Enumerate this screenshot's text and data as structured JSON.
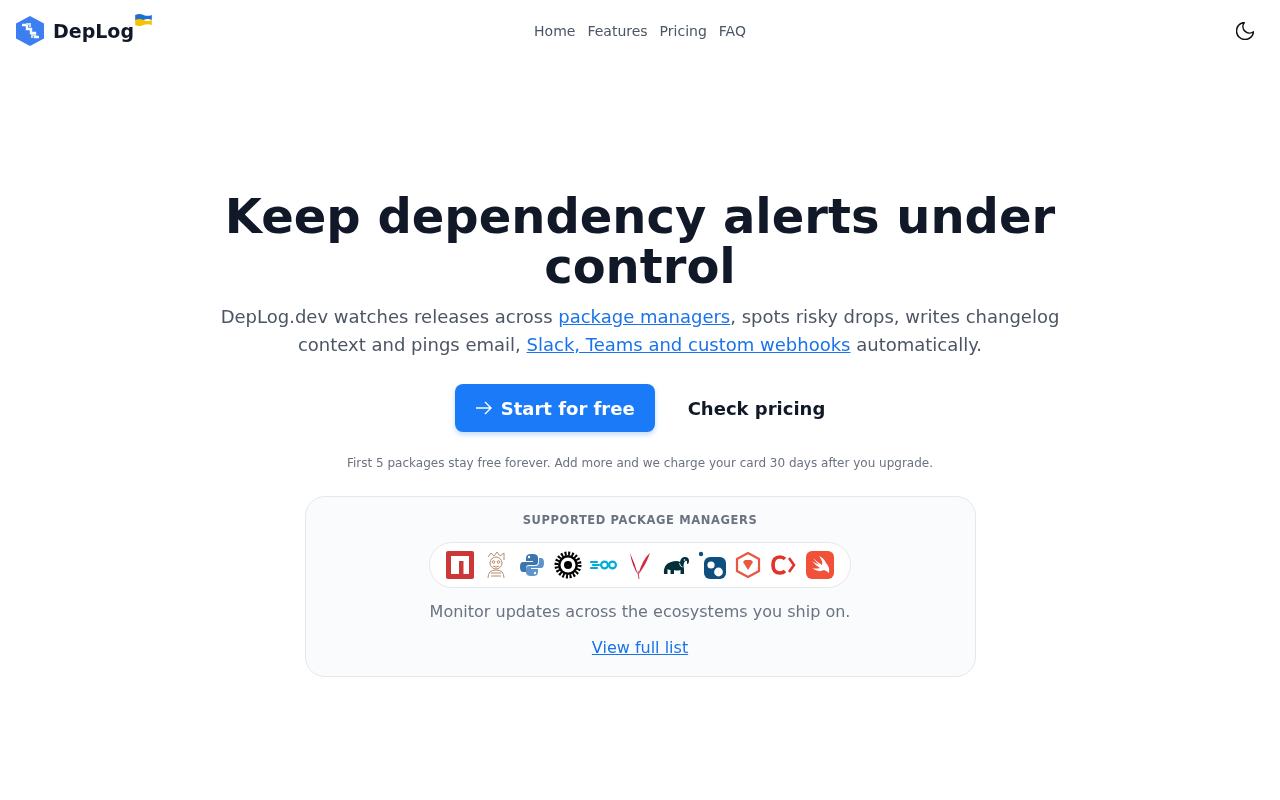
{
  "header": {
    "logo": {
      "name": "DepLog"
    },
    "nav": [
      {
        "label": "Home"
      },
      {
        "label": "Features"
      },
      {
        "label": "Pricing"
      },
      {
        "label": "FAQ"
      }
    ]
  },
  "hero": {
    "title": "Keep dependency alerts under control",
    "description": [
      {
        "kind": "text",
        "text": "DepLog.dev watches releases across "
      },
      {
        "kind": "link",
        "text": "package managers"
      },
      {
        "kind": "text",
        "text": ", spots risky drops, writes changelog context and pings email, "
      },
      {
        "kind": "link",
        "text": "Slack, Teams and custom webhooks"
      },
      {
        "kind": "text",
        "text": " automatically."
      }
    ],
    "buttons": [
      {
        "kind": "primary",
        "label": "Start for free"
      },
      {
        "kind": "secondary",
        "label": "Check pricing"
      }
    ],
    "note": "First 5 packages stay free forever. Add more and we charge your card 30 days after you upgrade."
  },
  "managers": {
    "heading": "SUPPORTED PACKAGE MANAGERS",
    "caption": "Monitor updates across the ecosystems you ship on.",
    "link": "View full list"
  }
}
